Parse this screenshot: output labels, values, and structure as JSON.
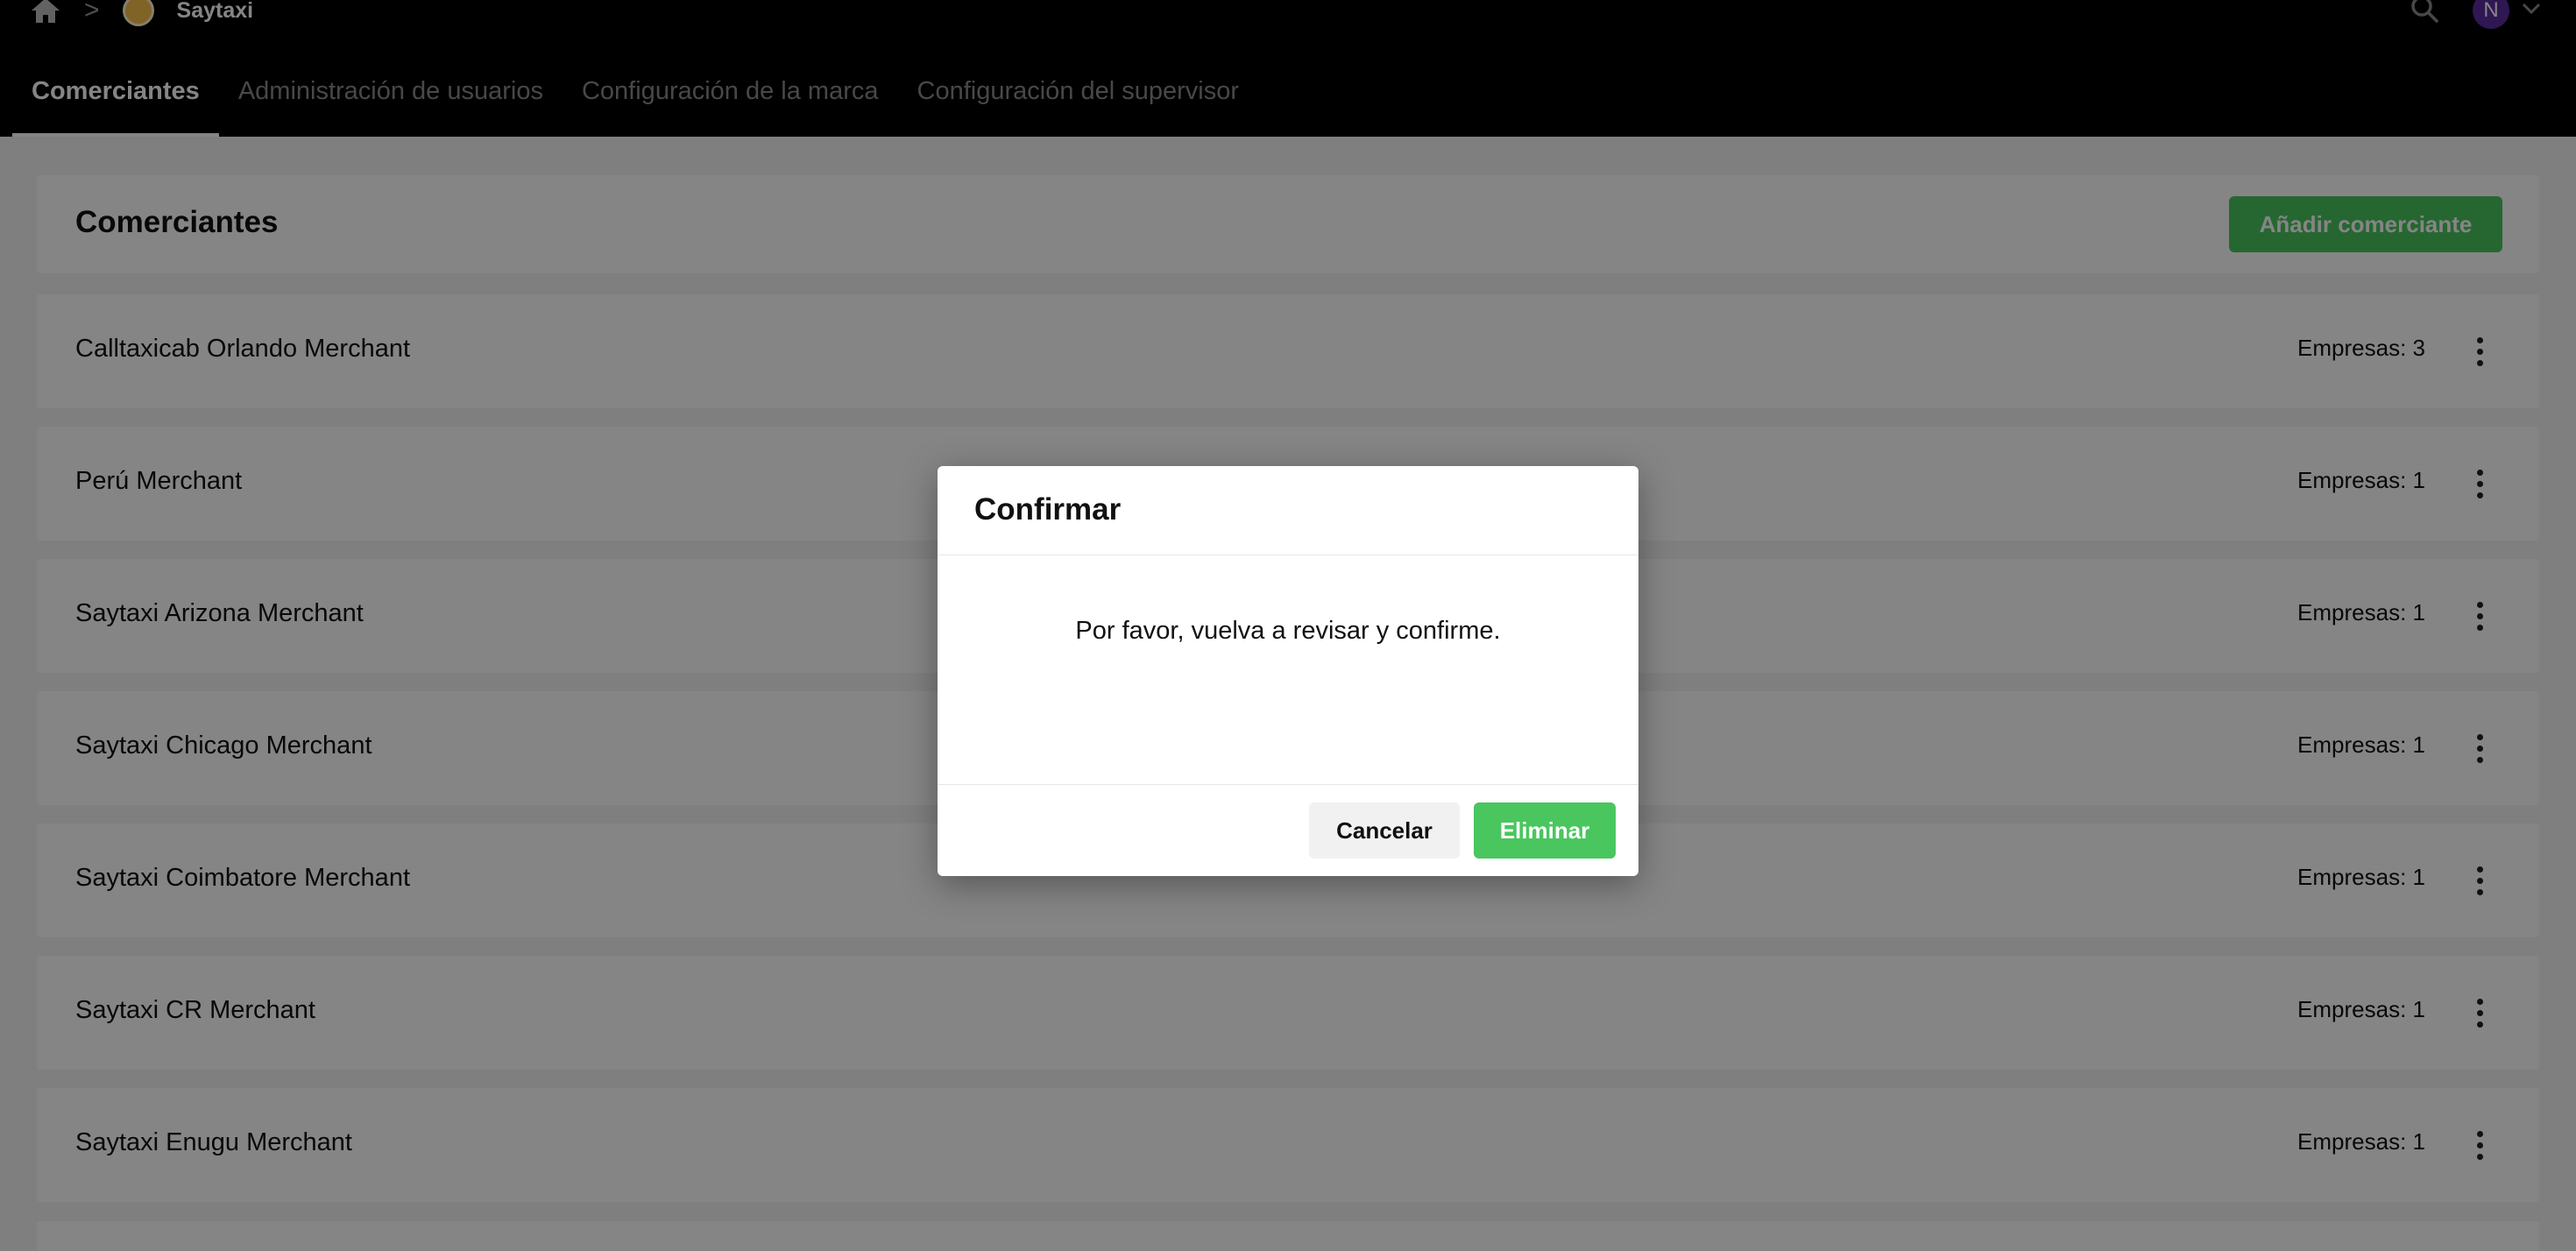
{
  "breadcrumb": {
    "home_icon": "home-icon",
    "separator": ">",
    "brand_name": "Saytaxi"
  },
  "user": {
    "avatar_initial": "N"
  },
  "nav": {
    "tabs": [
      {
        "label": "Comerciantes",
        "active": true
      },
      {
        "label": "Administración de usuarios",
        "active": false
      },
      {
        "label": "Configuración de la marca",
        "active": false
      },
      {
        "label": "Configuración del supervisor",
        "active": false
      }
    ]
  },
  "page": {
    "title": "Comerciantes",
    "add_button_label": "Añadir comerciante"
  },
  "merchants": [
    {
      "name": "Calltaxicab Orlando Merchant",
      "count": "Empresas: 3"
    },
    {
      "name": "Perú Merchant",
      "count": "Empresas: 1"
    },
    {
      "name": "Saytaxi Arizona Merchant",
      "count": "Empresas: 1"
    },
    {
      "name": "Saytaxi Chicago Merchant",
      "count": "Empresas: 1"
    },
    {
      "name": "Saytaxi Coimbatore Merchant",
      "count": "Empresas: 1"
    },
    {
      "name": "Saytaxi CR Merchant",
      "count": "Empresas: 1"
    },
    {
      "name": "Saytaxi Enugu Merchant",
      "count": "Empresas: 1"
    }
  ],
  "dialog": {
    "title": "Confirmar",
    "message": "Por favor, vuelva a revisar y confirme.",
    "cancel_label": "Cancelar",
    "delete_label": "Eliminar"
  },
  "colors": {
    "accent": "#4ac65f",
    "topbar": "#000000",
    "avatar": "#5b2ca0"
  }
}
